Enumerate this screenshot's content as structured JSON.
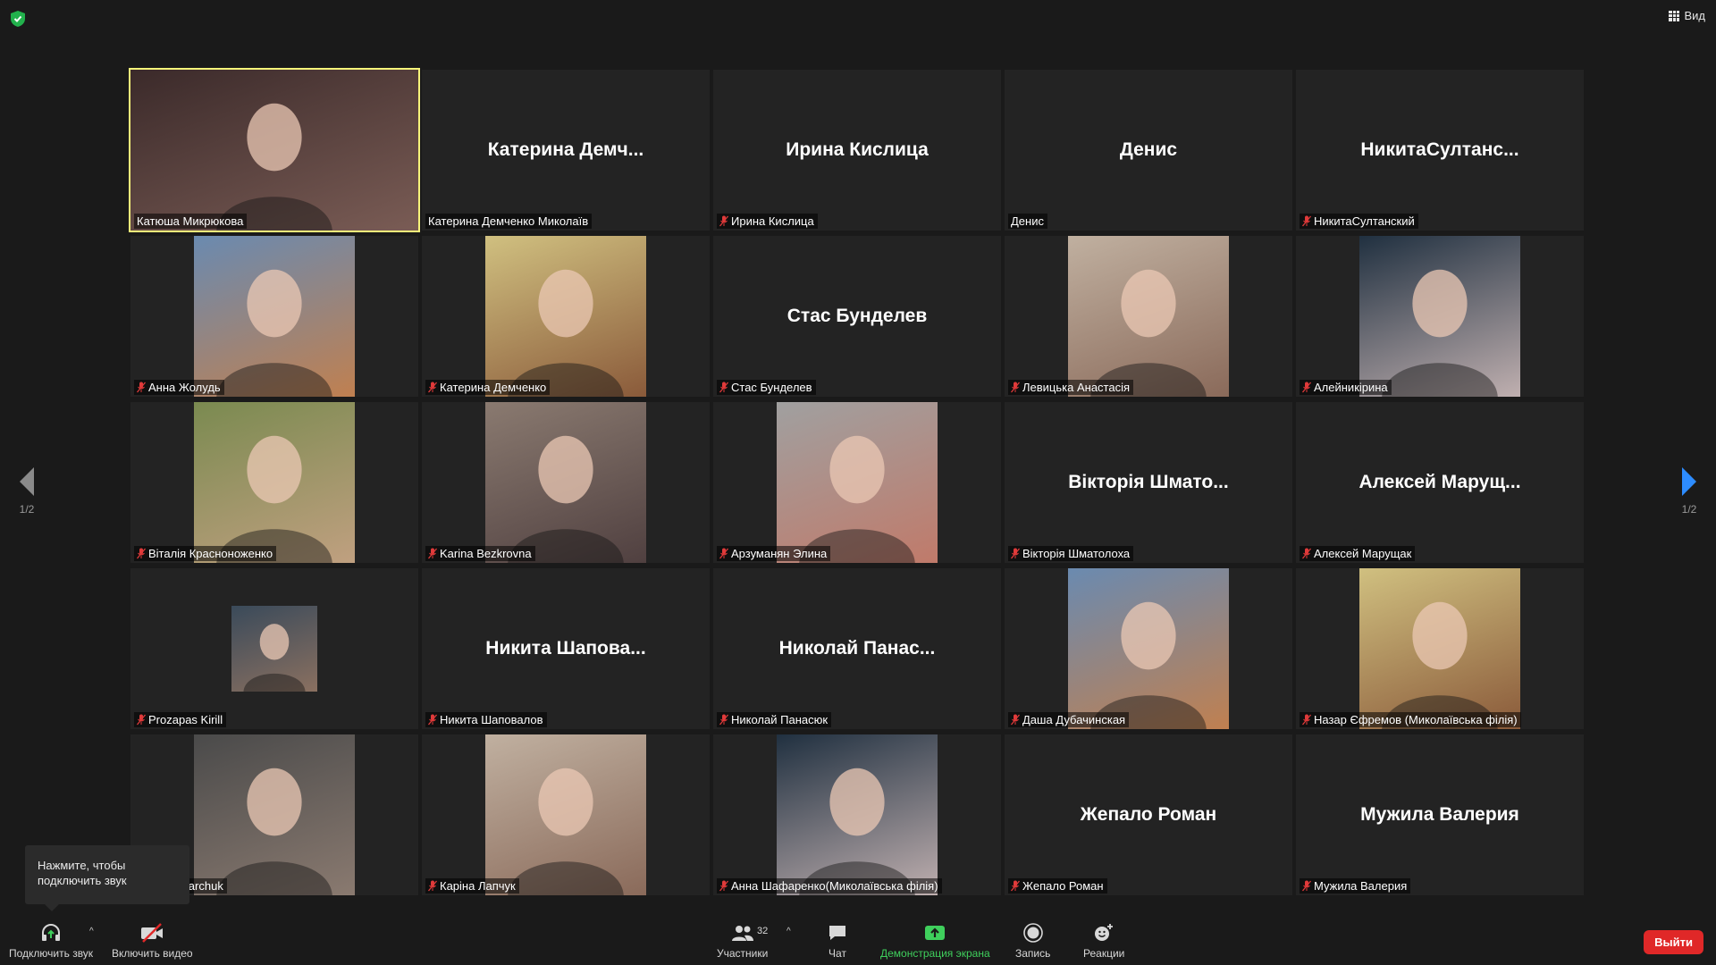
{
  "top_bar": {
    "view_label": "Вид"
  },
  "pagination": {
    "left": "1/2",
    "right": "1/2"
  },
  "tooltip": {
    "line1": "Нажмите, чтобы",
    "line2": "подключить звук"
  },
  "tiles": [
    {
      "label": "Катюша Микрюкова",
      "big": "",
      "muted": false,
      "photo": "camera"
    },
    {
      "label": "Катерина Демченко Миколаїв",
      "big": "Катерина  Демч...",
      "muted": false,
      "photo": ""
    },
    {
      "label": "Ирина Кислица",
      "big": "Ирина Кислица",
      "muted": true,
      "photo": ""
    },
    {
      "label": "Денис",
      "big": "Денис",
      "muted": false,
      "photo": ""
    },
    {
      "label": "НикитаСултанский",
      "big": "НикитаСултанс...",
      "muted": true,
      "photo": ""
    },
    {
      "label": "Анна Жолудь",
      "big": "",
      "muted": true,
      "photo": "photo"
    },
    {
      "label": "Катерина Демченко",
      "big": "",
      "muted": true,
      "photo": "photo"
    },
    {
      "label": "Стас Бунделев",
      "big": "Стас Бунделев",
      "muted": true,
      "photo": ""
    },
    {
      "label": "Левицька Анастасія",
      "big": "",
      "muted": true,
      "photo": "photo"
    },
    {
      "label": "Алейникірина",
      "big": "",
      "muted": true,
      "photo": "photo"
    },
    {
      "label": "Віталія Красноноженко",
      "big": "",
      "muted": true,
      "photo": "photo"
    },
    {
      "label": "Karina Bezkrovna",
      "big": "",
      "muted": true,
      "photo": "photo"
    },
    {
      "label": "Арзуманян Элина",
      "big": "",
      "muted": true,
      "photo": "photo"
    },
    {
      "label": "Вікторія Шматолоха",
      "big": "Вікторія  Шмато...",
      "muted": true,
      "photo": ""
    },
    {
      "label": "Алексей Марущак",
      "big": "Алексей  Марущ...",
      "muted": true,
      "photo": ""
    },
    {
      "label": "Prozapas Kirill",
      "big": "",
      "muted": true,
      "photo": "small"
    },
    {
      "label": "Никита Шаповалов",
      "big": "Никита  Шапова...",
      "muted": true,
      "photo": ""
    },
    {
      "label": "Николай Панасюк",
      "big": "Николай  Панас...",
      "muted": true,
      "photo": ""
    },
    {
      "label": "Даша Дубачинская",
      "big": "",
      "muted": true,
      "photo": "photo"
    },
    {
      "label": "Назар Єфремов (Миколаївська філія)",
      "big": "",
      "muted": true,
      "photo": "photo"
    },
    {
      "label": "...na Zakharchuk",
      "big": "",
      "muted": false,
      "photo": "photo"
    },
    {
      "label": "Каріна Лапчук",
      "big": "",
      "muted": true,
      "photo": "photo"
    },
    {
      "label": "Анна Шафаренко(Миколаївська філія)",
      "big": "",
      "muted": true,
      "photo": "photo"
    },
    {
      "label": "Жепало Роман",
      "big": "Жепало Роман",
      "muted": true,
      "photo": ""
    },
    {
      "label": "Мужила Валерия",
      "big": "Мужила Валерия",
      "muted": true,
      "photo": ""
    }
  ],
  "toolbar": {
    "audio": "Подключить звук",
    "video": "Включить видео",
    "participants": "Участники",
    "participants_count": "32",
    "chat": "Чат",
    "share": "Демонстрация экрана",
    "record": "Запись",
    "reactions": "Реакции",
    "exit": "Выйти"
  },
  "colors": {
    "active_border": "#f7f47a",
    "share_green": "#3fcf5c",
    "exit_red": "#e02828",
    "next_arrow": "#2d8cff"
  }
}
